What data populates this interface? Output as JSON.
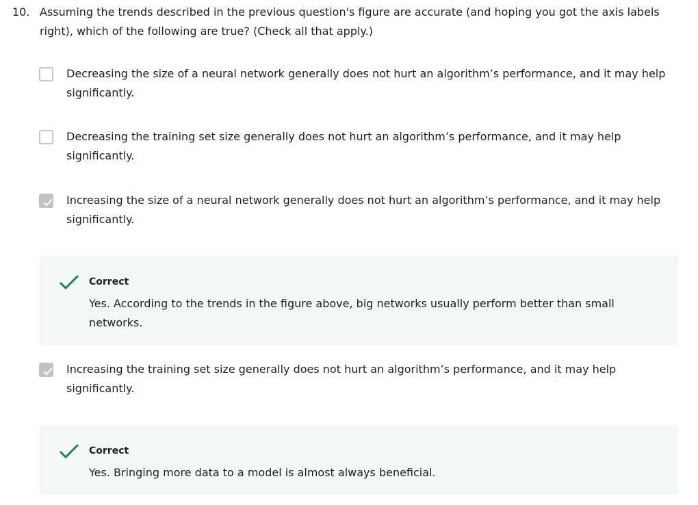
{
  "question": {
    "number": "10.",
    "text": "Assuming the trends described in the previous question's figure are accurate (and hoping you got the axis labels right), which of the following are true? (Check all that apply.)"
  },
  "options": [
    {
      "text": "Decreasing the size of a neural network generally does not hurt an algorithm’s performance, and it may help significantly.",
      "checked": false
    },
    {
      "text": "Decreasing the training set size generally does not hurt an algorithm’s performance, and it may help significantly.",
      "checked": false
    },
    {
      "text": "Increasing the size of a neural network generally does not hurt an algorithm’s performance, and it may help significantly.",
      "checked": true
    },
    {
      "text": "Increasing the training set size generally does not hurt an algorithm’s performance, and it may help significantly.",
      "checked": true
    }
  ],
  "feedback": [
    {
      "title": "Correct",
      "text": "Yes. According to the trends in the figure above, big networks usually perform better than small networks."
    },
    {
      "title": "Correct",
      "text": "Yes. Bringing more data to a model is almost always beneficial."
    }
  ],
  "colors": {
    "correct": "#1f8354",
    "feedback_bg": "#f3f8f6",
    "checkbox_checked": "#c2c2c2"
  }
}
